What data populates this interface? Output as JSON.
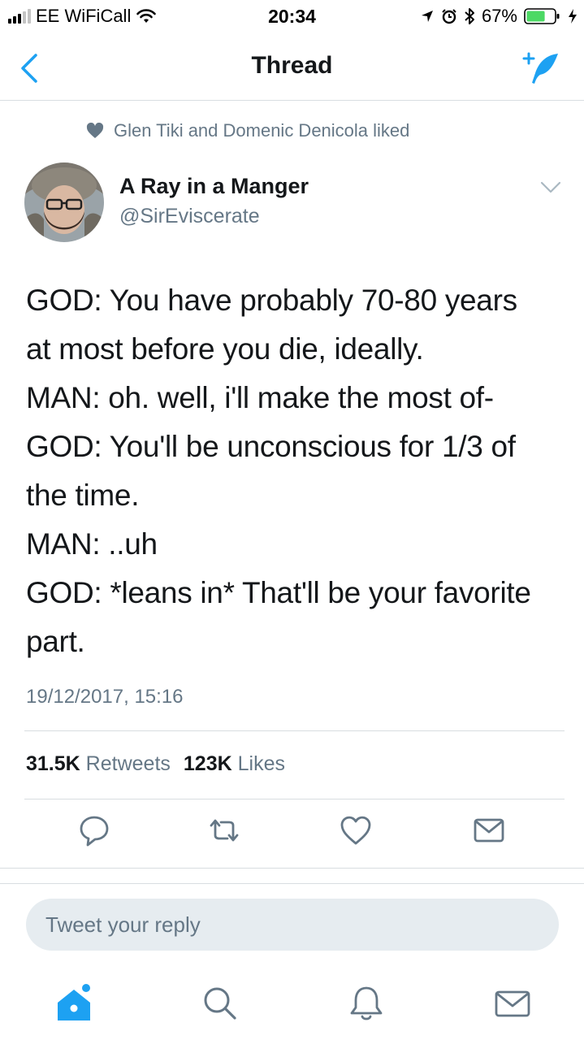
{
  "status_bar": {
    "carrier": "EE WiFiCall",
    "time": "20:34",
    "battery_percent": "67%",
    "battery_level": 0.67
  },
  "nav": {
    "title": "Thread"
  },
  "social_context": {
    "text": "Glen Tiki and Domenic Denicola liked"
  },
  "author": {
    "name": "A Ray in a Manger",
    "handle": "@SirEviscerate"
  },
  "tweet": {
    "lines": [
      "GOD: You have probably 70-80 years",
      "at most before you die, ideally.",
      "MAN: oh. well, i'll make the most of-",
      "GOD: You'll be unconscious for 1/3 of",
      "the time.",
      "MAN: ..uh",
      "GOD: *leans in* That'll be your favorite",
      "part."
    ],
    "timestamp": "19/12/2017, 15:16"
  },
  "stats": {
    "retweets_count": "31.5K",
    "retweets_label": "Retweets",
    "likes_count": "123K",
    "likes_label": "Likes"
  },
  "reply": {
    "placeholder": "Tweet your reply"
  },
  "colors": {
    "accent": "#1da1f2",
    "text": "#14171a",
    "secondary": "#657786",
    "border": "#d8dde1"
  },
  "icons": {
    "back": "chevron-left-icon",
    "compose": "compose-tweet-icon",
    "like_context": "heart-icon",
    "reply": "reply-icon",
    "retweet": "retweet-icon",
    "like": "heart-icon",
    "dm": "mail-icon",
    "home": "home-icon",
    "search": "search-icon",
    "notifications": "bell-icon",
    "messages": "mail-icon"
  }
}
